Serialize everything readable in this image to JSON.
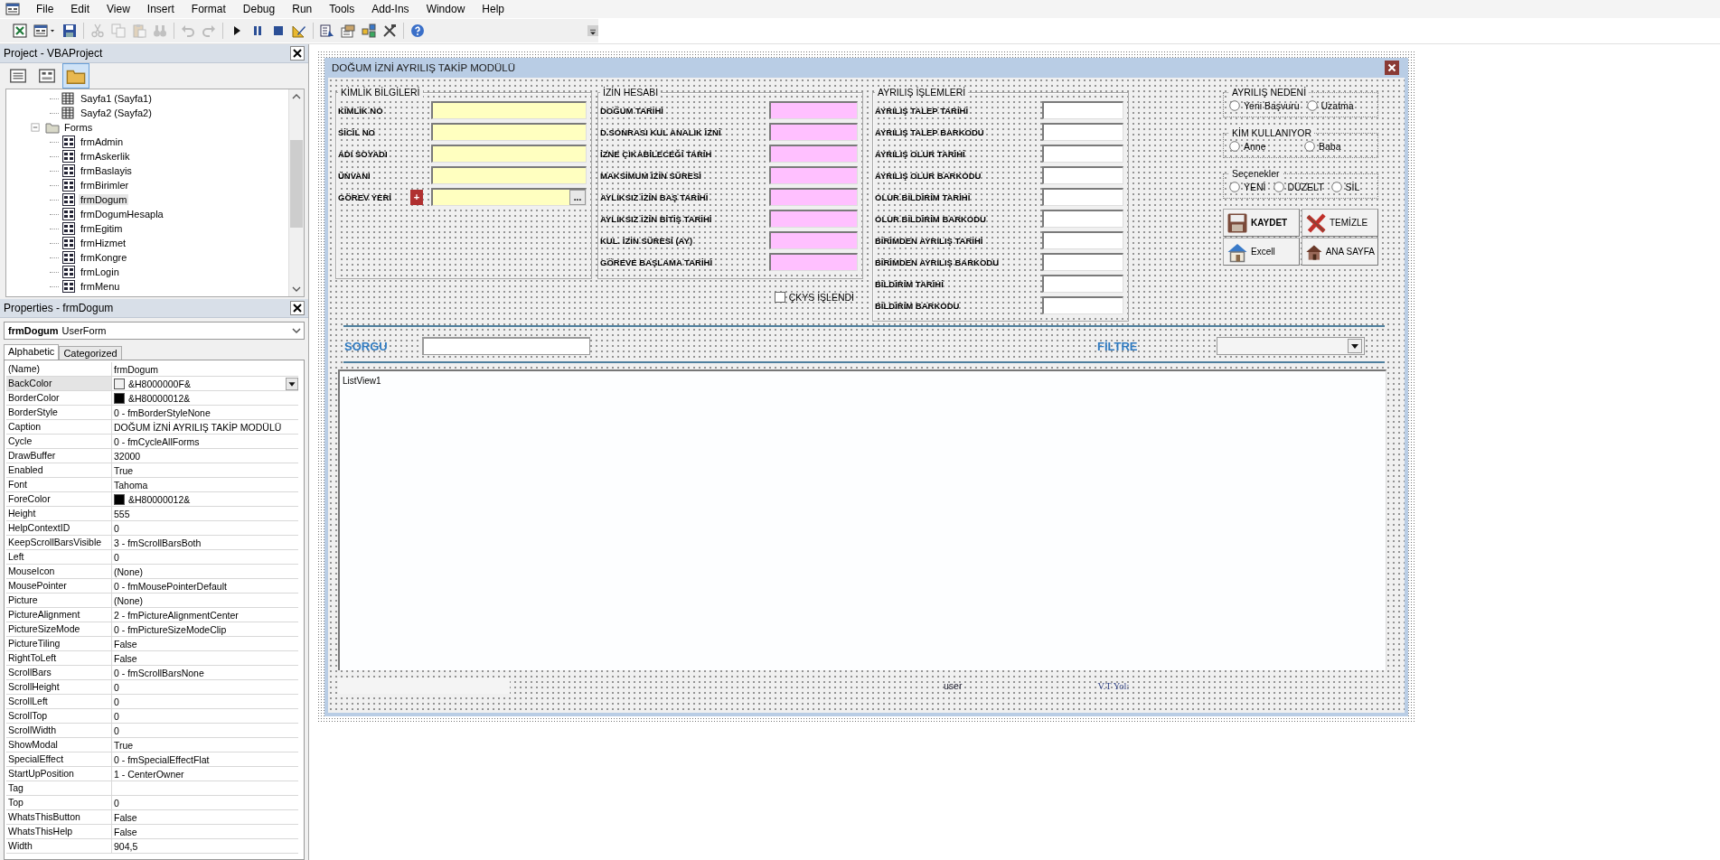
{
  "menu_bar": [
    "File",
    "Edit",
    "View",
    "Insert",
    "Format",
    "Debug",
    "Run",
    "Tools",
    "Add-Ins",
    "Window",
    "Help"
  ],
  "toolbar": [
    [
      {
        "kind": "spreadsheet",
        "disabled": false
      },
      {
        "kind": "form-menu",
        "disabled": false
      },
      {
        "kind": "save",
        "disabled": false
      }
    ],
    [
      {
        "kind": "cut",
        "disabled": true
      },
      {
        "kind": "copy",
        "disabled": true
      },
      {
        "kind": "paste",
        "disabled": true
      },
      {
        "kind": "binoculars",
        "disabled": true
      }
    ],
    [
      {
        "kind": "undo",
        "disabled": true
      },
      {
        "kind": "redo",
        "disabled": true
      }
    ],
    [
      {
        "kind": "play",
        "disabled": false
      },
      {
        "kind": "pause",
        "disabled": false
      },
      {
        "kind": "stop",
        "disabled": false
      },
      {
        "kind": "ruler",
        "disabled": false
      }
    ],
    [
      {
        "kind": "explorer",
        "disabled": false
      },
      {
        "kind": "properties",
        "disabled": false
      },
      {
        "kind": "object-browser",
        "disabled": false
      },
      {
        "kind": "tools",
        "disabled": false
      }
    ],
    [
      {
        "kind": "help",
        "disabled": false
      }
    ]
  ],
  "project_pane": {
    "title": "Project - VBAProject",
    "buttons": [
      {
        "kind": "view-code",
        "selected": false
      },
      {
        "kind": "view-object",
        "selected": false
      },
      {
        "kind": "toggle-folders",
        "selected": true
      }
    ],
    "tree": [
      {
        "label": "Sayfa1 (Sayfa1)",
        "kind": "sheet",
        "selected": false
      },
      {
        "label": "Sayfa2 (Sayfa2)",
        "kind": "sheet",
        "selected": false
      },
      {
        "label": "Forms",
        "kind": "folder",
        "expanded": true,
        "selected": false,
        "children": [
          {
            "label": "frmAdmin",
            "kind": "form",
            "selected": false
          },
          {
            "label": "frmAskerlik",
            "kind": "form",
            "selected": false
          },
          {
            "label": "frmBaslayis",
            "kind": "form",
            "selected": false
          },
          {
            "label": "frmBirimler",
            "kind": "form",
            "selected": false
          },
          {
            "label": "frmDogum",
            "kind": "form",
            "selected": true
          },
          {
            "label": "frmDogumHesapla",
            "kind": "form",
            "selected": false
          },
          {
            "label": "frmEgitim",
            "kind": "form",
            "selected": false
          },
          {
            "label": "frmHizmet",
            "kind": "form",
            "selected": false
          },
          {
            "label": "frmKongre",
            "kind": "form",
            "selected": false
          },
          {
            "label": "frmLogin",
            "kind": "form",
            "selected": false
          },
          {
            "label": "frmMenu",
            "kind": "form",
            "selected": false
          }
        ]
      }
    ]
  },
  "properties_pane": {
    "title": "Properties - frmDogum",
    "object_name": "frmDogum",
    "object_type": "UserForm",
    "tabs": [
      {
        "label": "Alphabetic",
        "selected": true
      },
      {
        "label": "Categorized",
        "selected": false
      }
    ],
    "rows": [
      {
        "name": "(Name)",
        "value": "frmDogum",
        "selected": false
      },
      {
        "name": "BackColor",
        "value": "&H8000000F&",
        "color": "#f0f0f0",
        "selected": true
      },
      {
        "name": "BorderColor",
        "value": "&H80000012&",
        "color": "#000000",
        "selected": false
      },
      {
        "name": "BorderStyle",
        "value": "0 - fmBorderStyleNone",
        "selected": false
      },
      {
        "name": "Caption",
        "value": "DOĞUM İZNİ AYRILIŞ TAKİP MODÜLÜ",
        "selected": false
      },
      {
        "name": "Cycle",
        "value": "0 - fmCycleAllForms",
        "selected": false
      },
      {
        "name": "DrawBuffer",
        "value": "32000",
        "selected": false
      },
      {
        "name": "Enabled",
        "value": "True",
        "selected": false
      },
      {
        "name": "Font",
        "value": "Tahoma",
        "selected": false
      },
      {
        "name": "ForeColor",
        "value": "&H80000012&",
        "color": "#000000",
        "selected": false
      },
      {
        "name": "Height",
        "value": "555",
        "selected": false
      },
      {
        "name": "HelpContextID",
        "value": "0",
        "selected": false
      },
      {
        "name": "KeepScrollBarsVisible",
        "value": "3 - fmScrollBarsBoth",
        "selected": false
      },
      {
        "name": "Left",
        "value": "0",
        "selected": false
      },
      {
        "name": "MouseIcon",
        "value": "(None)",
        "selected": false
      },
      {
        "name": "MousePointer",
        "value": "0 - fmMousePointerDefault",
        "selected": false
      },
      {
        "name": "Picture",
        "value": "(None)",
        "selected": false
      },
      {
        "name": "PictureAlignment",
        "value": "2 - fmPictureAlignmentCenter",
        "selected": false
      },
      {
        "name": "PictureSizeMode",
        "value": "0 - fmPictureSizeModeClip",
        "selected": false
      },
      {
        "name": "PictureTiling",
        "value": "False",
        "selected": false
      },
      {
        "name": "RightToLeft",
        "value": "False",
        "selected": false
      },
      {
        "name": "ScrollBars",
        "value": "0 - fmScrollBarsNone",
        "selected": false
      },
      {
        "name": "ScrollHeight",
        "value": "0",
        "selected": false
      },
      {
        "name": "ScrollLeft",
        "value": "0",
        "selected": false
      },
      {
        "name": "ScrollTop",
        "value": "0",
        "selected": false
      },
      {
        "name": "ScrollWidth",
        "value": "0",
        "selected": false
      },
      {
        "name": "ShowModal",
        "value": "True",
        "selected": false
      },
      {
        "name": "SpecialEffect",
        "value": "0 - fmSpecialEffectFlat",
        "selected": false
      },
      {
        "name": "StartUpPosition",
        "value": "1 - CenterOwner",
        "selected": false
      },
      {
        "name": "Tag",
        "selected": false
      },
      {
        "name": "Top",
        "value": "0",
        "selected": false
      },
      {
        "name": "WhatsThisButton",
        "value": "False",
        "selected": false
      },
      {
        "name": "WhatsThisHelp",
        "value": "False",
        "selected": false
      },
      {
        "name": "Width",
        "value": "904,5",
        "selected": false
      }
    ]
  },
  "form": {
    "title": "DOĞUM İZNİ AYRILIŞ TAKİP MODÜLÜ",
    "frames": [
      {
        "title": "KİMLİK BİLGİLERİ",
        "color": "#ffffc0",
        "fields": [
          {
            "label": "KİMLİK NO",
            "kind": "text"
          },
          {
            "label": "SİCİL NO",
            "kind": "text"
          },
          {
            "label": "ADI SOYADI",
            "kind": "text"
          },
          {
            "label": "ÜNVANI",
            "kind": "text"
          },
          {
            "label": "GÖREV YERİ",
            "kind": "browse",
            "add_button": "+",
            "browse_button": "..."
          }
        ]
      },
      {
        "title": "İZİN HESABI",
        "color": "#ffc0ff",
        "fields": [
          {
            "label": "DOĞUM TARİHİ",
            "kind": "text"
          },
          {
            "label": "D.SONRASI KUL ANALIK İZNİ",
            "kind": "text"
          },
          {
            "label": "İZNE ÇIKABİLECEĞİ TARİH",
            "kind": "text"
          },
          {
            "label": "MAKSİMUM İZİN SÜRESİ",
            "kind": "text"
          },
          {
            "label": "AYLIKSIZ İZİN BAŞ TARİHİ",
            "kind": "text"
          },
          {
            "label": "AYLIKSIZ İZİN BİTİŞ TARİHİ",
            "kind": "text"
          },
          {
            "label": "KUL. İZİN SÜRESİ (AY)",
            "kind": "text"
          },
          {
            "label": "GÖREVE BAŞLAMA TARİHİ",
            "kind": "text"
          }
        ]
      },
      {
        "title": "AYRILIŞ İŞLEMLERİ",
        "color": "#ffffff",
        "fields": [
          {
            "label": "AYRILIŞ TALEP TARİHİ",
            "kind": "text"
          },
          {
            "label": "AYRILIŞ TALEP BARKODU",
            "kind": "text"
          },
          {
            "label": "AYRILIŞ OLUR TARİHİ",
            "kind": "text"
          },
          {
            "label": "AYRILIŞ OLUR BARKODU",
            "kind": "text"
          },
          {
            "label": "OLUR BİLDİRİM TARİHİ",
            "kind": "text"
          },
          {
            "label": "OLUR BİLDİRİM BARKODU",
            "kind": "text"
          },
          {
            "label": "BİRİMDEN AYRILIŞ TARİHİ",
            "kind": "text"
          },
          {
            "label": "BİRİMDEN AYRILIŞ BARKODU",
            "kind": "text"
          },
          {
            "label": "BİLDİRİM TARİHİ",
            "kind": "text"
          },
          {
            "label": "BİLDİRİM BARKODU",
            "kind": "text"
          }
        ]
      }
    ],
    "checkbox": {
      "label": "ÇKYS İŞLENDİ",
      "checked": false
    },
    "option_groups": [
      {
        "title": "AYRILIŞ NEDENİ",
        "options": [
          {
            "label": "Yeni Başvuru",
            "selected": false
          },
          {
            "label": "Uzatma",
            "selected": false
          }
        ]
      },
      {
        "title": "KİM KULLANIYOR",
        "options": [
          {
            "label": "Anne",
            "selected": false
          },
          {
            "label": "Baba",
            "selected": false
          }
        ]
      },
      {
        "title": "Seçenekler",
        "options": [
          {
            "label": "YENİ",
            "selected": false
          },
          {
            "label": "DÜZELT",
            "selected": false
          },
          {
            "label": "SİL",
            "selected": false
          }
        ]
      }
    ],
    "buttons": [
      {
        "label": "KAYDET",
        "kind": "floppy",
        "bold": true
      },
      {
        "label": "TEMİZLE",
        "kind": "cross",
        "bold": false
      },
      {
        "label": "Excell",
        "kind": "house-blue",
        "bold": false
      },
      {
        "label": "ANA SAYFA",
        "kind": "house-brown",
        "bold": false
      }
    ],
    "query_label": "SORGU",
    "filter_label": "FİLTRE",
    "list_view": "ListView1",
    "status": [
      "user",
      "V.T Yol:"
    ]
  }
}
